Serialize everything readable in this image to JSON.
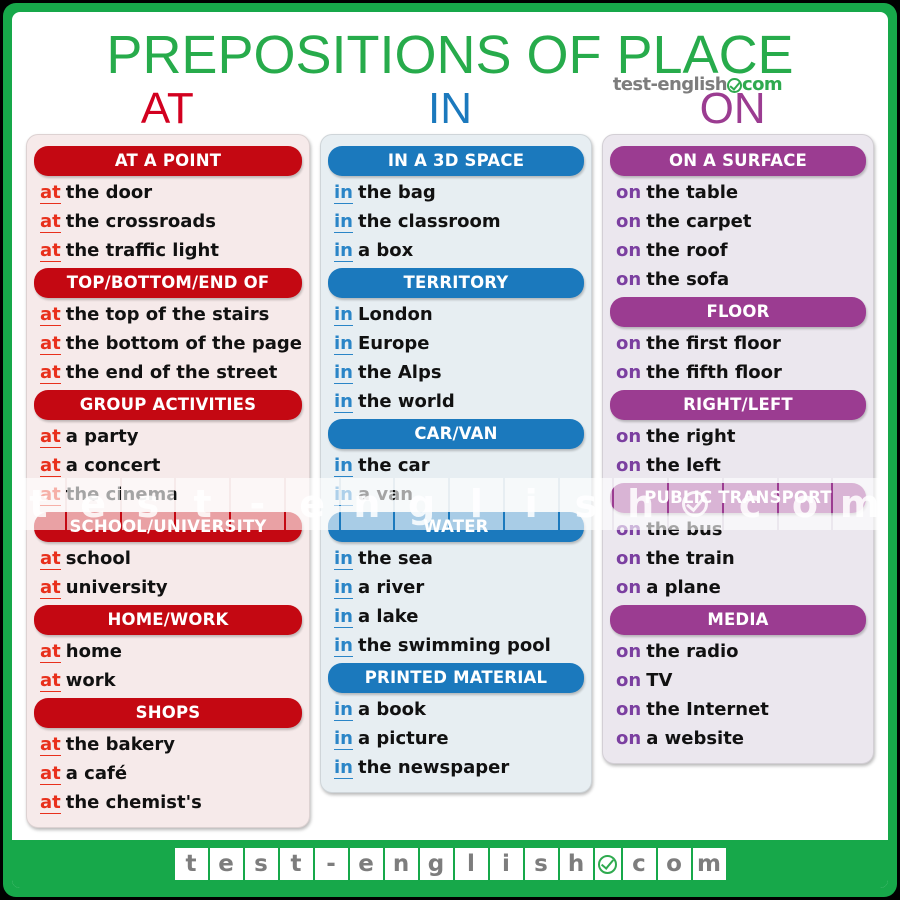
{
  "poster": {
    "title": "PREPOSITIONS OF PLACE",
    "brand": {
      "name": "test-english",
      "suffix": "com",
      "badge_icon": "check-circle-icon"
    },
    "colors": {
      "frame_green": "#17a84a",
      "title_green": "#27ab4b",
      "at_red": "#c40812",
      "at_text_red": "#e8301c",
      "in_blue": "#1b79bd",
      "in_text_blue": "#2a85c7",
      "on_purple": "#9b3c91",
      "on_text_purple": "#7b3fa0"
    }
  },
  "columns": [
    {
      "key": "at",
      "title": "AT",
      "groups": [
        {
          "heading": "AT A POINT",
          "entries": [
            {
              "prep": "at",
              "phrase": "the door"
            },
            {
              "prep": "at",
              "phrase": "the crossroads"
            },
            {
              "prep": "at",
              "phrase": "the traffic light"
            }
          ]
        },
        {
          "heading": "TOP/BOTTOM/END OF",
          "entries": [
            {
              "prep": "at",
              "phrase": "the top  of the stairs"
            },
            {
              "prep": "at",
              "phrase": "the bottom of the page"
            },
            {
              "prep": "at",
              "phrase": "the end of the street"
            }
          ]
        },
        {
          "heading": "GROUP ACTIVITIES",
          "entries": [
            {
              "prep": "at",
              "phrase": "a party"
            },
            {
              "prep": "at",
              "phrase": "a concert"
            },
            {
              "prep": "at",
              "phrase": "the cinema"
            }
          ]
        },
        {
          "heading": "SCHOOL/UNIVERSITY",
          "entries": [
            {
              "prep": "at",
              "phrase": "school"
            },
            {
              "prep": "at",
              "phrase": "university"
            }
          ]
        },
        {
          "heading": "HOME/WORK",
          "entries": [
            {
              "prep": "at",
              "phrase": "home"
            },
            {
              "prep": "at",
              "phrase": "work"
            }
          ]
        },
        {
          "heading": "SHOPS",
          "entries": [
            {
              "prep": "at",
              "phrase": "the bakery"
            },
            {
              "prep": "at",
              "phrase": "a café"
            },
            {
              "prep": "at",
              "phrase": "the chemist's"
            }
          ]
        }
      ]
    },
    {
      "key": "in",
      "title": "IN",
      "groups": [
        {
          "heading": "IN A 3D SPACE",
          "entries": [
            {
              "prep": "in",
              "phrase": "the bag"
            },
            {
              "prep": "in",
              "phrase": "the classroom"
            },
            {
              "prep": "in",
              "phrase": "a box"
            }
          ]
        },
        {
          "heading": "TERRITORY",
          "entries": [
            {
              "prep": "in",
              "phrase": "London"
            },
            {
              "prep": "in",
              "phrase": "Europe"
            },
            {
              "prep": "in",
              "phrase": "the Alps"
            },
            {
              "prep": "in",
              "phrase": "the world"
            }
          ]
        },
        {
          "heading": "CAR/VAN",
          "entries": [
            {
              "prep": "in",
              "phrase": "the car"
            },
            {
              "prep": "in",
              "phrase": "a van"
            }
          ]
        },
        {
          "heading": "WATER",
          "entries": [
            {
              "prep": "in",
              "phrase": "the sea"
            },
            {
              "prep": "in",
              "phrase": "a river"
            },
            {
              "prep": "in",
              "phrase": "a lake"
            },
            {
              "prep": "in",
              "phrase": "the swimming pool"
            }
          ]
        },
        {
          "heading": "PRINTED MATERIAL",
          "entries": [
            {
              "prep": "in",
              "phrase": "a book"
            },
            {
              "prep": "in",
              "phrase": "a picture"
            },
            {
              "prep": "in",
              "phrase": "the newspaper"
            }
          ]
        }
      ]
    },
    {
      "key": "on",
      "title": "ON",
      "groups": [
        {
          "heading": "ON A SURFACE",
          "entries": [
            {
              "prep": "on",
              "phrase": "the table"
            },
            {
              "prep": "on",
              "phrase": "the carpet"
            },
            {
              "prep": "on",
              "phrase": "the roof"
            },
            {
              "prep": "on",
              "phrase": "the sofa"
            }
          ]
        },
        {
          "heading": "FLOOR",
          "entries": [
            {
              "prep": "on",
              "phrase": "the first floor"
            },
            {
              "prep": "on",
              "phrase": "the fifth floor"
            }
          ]
        },
        {
          "heading": "RIGHT/LEFT",
          "entries": [
            {
              "prep": "on",
              "phrase": "the right"
            },
            {
              "prep": "on",
              "phrase": "the left"
            }
          ]
        },
        {
          "heading": "PUBLIC TRANSPORT",
          "entries": [
            {
              "prep": "on",
              "phrase": "the bus"
            },
            {
              "prep": "on",
              "phrase": "the train"
            },
            {
              "prep": "on",
              "phrase": "a plane"
            }
          ]
        },
        {
          "heading": "MEDIA",
          "entries": [
            {
              "prep": "on",
              "phrase": "the radio"
            },
            {
              "prep": "on",
              "phrase": "TV"
            },
            {
              "prep": "on",
              "phrase": "the Internet"
            },
            {
              "prep": "on",
              "phrase": "a website"
            }
          ]
        }
      ]
    }
  ],
  "watermark": {
    "cells": [
      "t",
      "e",
      "s",
      "t",
      "-",
      "e",
      "n",
      "g",
      "l",
      "i",
      "s",
      "h",
      "check-circle-icon",
      "c",
      "o",
      "m"
    ]
  },
  "footer": {
    "cells": [
      "t",
      "e",
      "s",
      "t",
      "-",
      "e",
      "n",
      "g",
      "l",
      "i",
      "s",
      "h",
      "check-circle-icon",
      "c",
      "o",
      "m"
    ]
  }
}
